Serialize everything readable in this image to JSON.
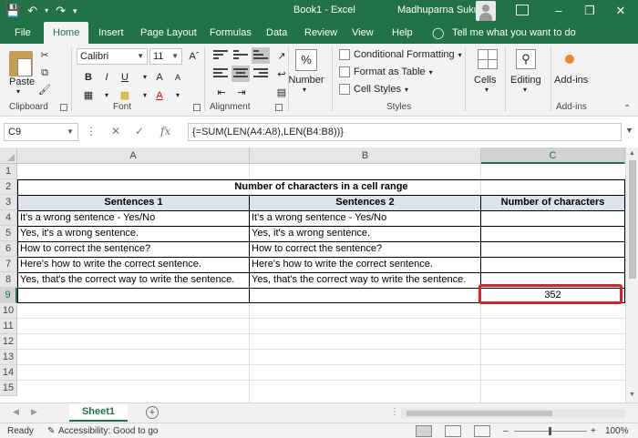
{
  "titlebar": {
    "doc_title": "Book1  -  Excel",
    "user_name": "Madhuparna Sukul"
  },
  "tabs": [
    "File",
    "Home",
    "Insert",
    "Page Layout",
    "Formulas",
    "Data",
    "Review",
    "View",
    "Help"
  ],
  "tell_me": "Tell me what you want to do",
  "ribbon": {
    "clipboard": {
      "paste": "Paste",
      "label": "Clipboard"
    },
    "font": {
      "name": "Calibri",
      "size": "11",
      "label": "Font"
    },
    "alignment": {
      "label": "Alignment"
    },
    "number": {
      "button": "Number",
      "symbol": "%"
    },
    "styles": {
      "conditional": "Conditional Formatting",
      "format_table": "Format as Table",
      "cell_styles": "Cell Styles",
      "label": "Styles"
    },
    "cells": {
      "button": "Cells"
    },
    "editing": {
      "button": "Editing"
    },
    "addins": {
      "button": "Add-ins",
      "label": "Add-ins"
    }
  },
  "formula_bar": {
    "name_box": "C9",
    "formula": "{=SUM(LEN(A4:A8),LEN(B4:B8))}"
  },
  "columns": [
    "A",
    "B",
    "C"
  ],
  "rows": [
    "1",
    "2",
    "3",
    "4",
    "5",
    "6",
    "7",
    "8",
    "9",
    "10",
    "11",
    "12",
    "13",
    "14",
    "15"
  ],
  "sheet": {
    "title": "Number of characters in a cell range",
    "headers": [
      "Sentences 1",
      "Sentences 2",
      "Number of characters"
    ],
    "data_rows": [
      [
        "It's a wrong sentence - Yes/No",
        "It's a wrong sentence - Yes/No",
        ""
      ],
      [
        "Yes, it's a wrong sentence.",
        "Yes, it's a wrong sentence.",
        ""
      ],
      [
        "How to correct the sentence?",
        "How to correct the sentence?",
        ""
      ],
      [
        "Here's how to write the correct sentence.",
        "Here's how to write the correct sentence.",
        ""
      ],
      [
        "Yes, that's the correct way to write the sentence.",
        "Yes, that's the correct way to write the sentence.",
        ""
      ]
    ],
    "result": "352"
  },
  "sheet_tabs": {
    "active": "Sheet1"
  },
  "status": {
    "ready": "Ready",
    "accessibility": "Accessibility: Good to go",
    "zoom": "100%"
  },
  "colors": {
    "excel_green": "#217346",
    "highlight": "#e0202a",
    "header_fill": "#dde3ec"
  }
}
